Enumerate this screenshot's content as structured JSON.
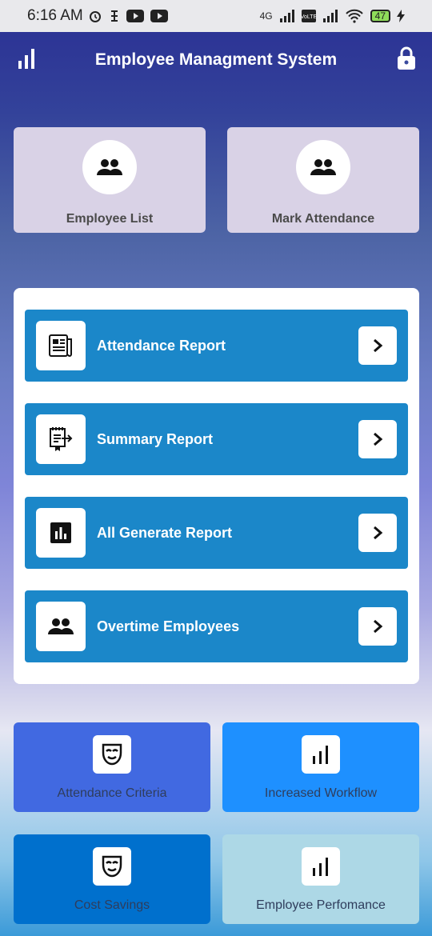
{
  "status_bar": {
    "time": "6:16 AM",
    "network": "4G",
    "volte": "Vo LTE",
    "battery": "47"
  },
  "app_bar": {
    "title": "Employee Managment System"
  },
  "top_cards": [
    {
      "label": "Employee List",
      "icon": "people-icon"
    },
    {
      "label": "Mark Attendance",
      "icon": "people-icon"
    }
  ],
  "reports": [
    {
      "label": "Attendance Report",
      "icon": "newspaper-icon"
    },
    {
      "label": "Summary Report",
      "icon": "export-document-icon"
    },
    {
      "label": "All Generate Report",
      "icon": "bar-chart-icon"
    },
    {
      "label": "Overtime Employees",
      "icon": "people-icon"
    }
  ],
  "tiles": [
    {
      "label": "Attendance Criteria",
      "icon": "theater-mask-icon",
      "color": "#4169e1"
    },
    {
      "label": "Increased Workflow",
      "icon": "bar-chart-icon",
      "color": "#1e90ff"
    },
    {
      "label": "Cost Savings",
      "icon": "theater-mask-icon",
      "color": "#0070cd"
    },
    {
      "label": "Employee Perfomance",
      "icon": "bar-chart-icon",
      "color": "#add8e6"
    }
  ],
  "colors": {
    "report_row": "#1b87c9",
    "top_card": "#d9d2e6"
  }
}
